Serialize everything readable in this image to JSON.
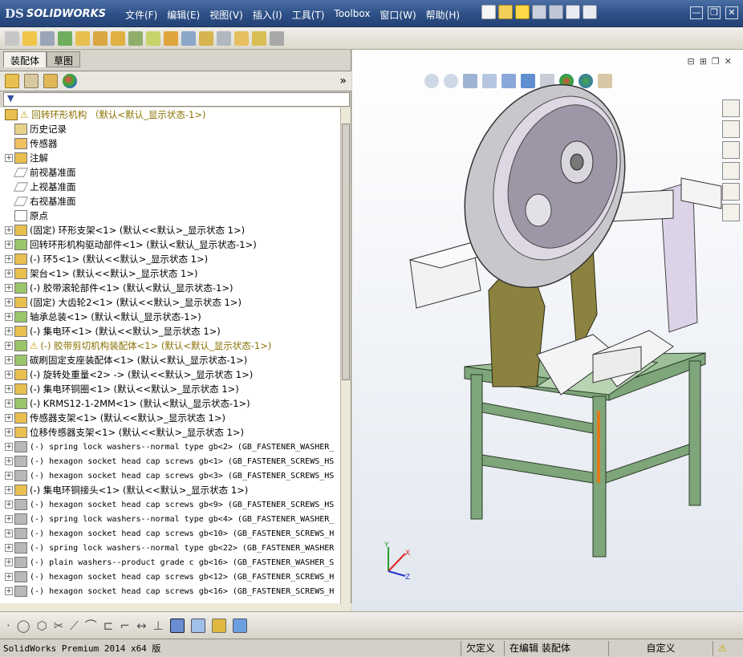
{
  "app": {
    "brand": "SOLIDWORKS",
    "brand_prefix": "DS"
  },
  "menu": [
    "文件(F)",
    "编辑(E)",
    "视图(V)",
    "插入(I)",
    "工具(T)",
    "Toolbox",
    "窗口(W)",
    "帮助(H)"
  ],
  "window_controls": {
    "minimize": "—",
    "restore": "❐",
    "close": "✕"
  },
  "tabs": [
    {
      "label": "装配体",
      "active": true
    },
    {
      "label": "草图",
      "active": false
    }
  ],
  "fm_expand": "»",
  "tree": {
    "root": "回转环形机构  （默认<默认_显示状态-1>)",
    "items": [
      {
        "label": "历史记录",
        "icon": "history-icon",
        "exp": false,
        "mono": false
      },
      {
        "label": "传感器",
        "icon": "sensor-icon",
        "exp": false,
        "mono": false
      },
      {
        "label": "注解",
        "icon": "annotation-icon",
        "exp": true,
        "mono": false
      },
      {
        "label": "前视基准面",
        "icon": "plane-icon",
        "exp": false,
        "mono": false
      },
      {
        "label": "上视基准面",
        "icon": "plane-icon",
        "exp": false,
        "mono": false
      },
      {
        "label": "右视基准面",
        "icon": "plane-icon",
        "exp": false,
        "mono": false
      },
      {
        "label": "原点",
        "icon": "origin-icon",
        "exp": false,
        "mono": false
      },
      {
        "label": "(固定) 环形支架<1> (默认<<默认>_显示状态 1>)",
        "icon": "part-icon",
        "exp": true,
        "mono": false
      },
      {
        "label": "回转环形机构驱动部件<1> (默认<默认_显示状态-1>)",
        "icon": "assembly-icon",
        "exp": true,
        "mono": false
      },
      {
        "label": "(-) 环5<1> (默认<<默认>_显示状态 1>)",
        "icon": "part-icon",
        "exp": true,
        "mono": false
      },
      {
        "label": "架台<1> (默认<<默认>_显示状态 1>)",
        "icon": "part-icon",
        "exp": true,
        "mono": false
      },
      {
        "label": "(-) 胶带滚轮部件<1> (默认<默认_显示状态-1>)",
        "icon": "assembly-icon",
        "exp": true,
        "mono": false
      },
      {
        "label": "(固定) 大齿轮2<1> (默认<<默认>_显示状态 1>)",
        "icon": "part-icon",
        "exp": true,
        "mono": false
      },
      {
        "label": "轴承总装<1> (默认<默认_显示状态-1>)",
        "icon": "assembly-icon",
        "exp": true,
        "mono": false
      },
      {
        "label": "(-) 集电环<1> (默认<<默认>_显示状态 1>)",
        "icon": "part-icon",
        "exp": true,
        "mono": false
      },
      {
        "label": "(-) 胶带剪切机构装配体<1> (默认<默认_显示状态-1>)",
        "icon": "assembly-warning-icon",
        "exp": true,
        "mono": false,
        "warn": true
      },
      {
        "label": "碳刷固定支座装配体<1> (默认<默认_显示状态-1>)",
        "icon": "assembly-icon",
        "exp": true,
        "mono": false
      },
      {
        "label": "(-) 旋转处重量<2> -> (默认<<默认>_显示状态 1>)",
        "icon": "part-icon",
        "exp": true,
        "mono": false
      },
      {
        "label": "(-) 集电环铜圈<1> (默认<<默认>_显示状态 1>)",
        "icon": "part-icon",
        "exp": true,
        "mono": false
      },
      {
        "label": "(-) KRMS12-1-2MM<1> (默认<默认_显示状态-1>)",
        "icon": "assembly-icon",
        "exp": true,
        "mono": false
      },
      {
        "label": "传感器支架<1> (默认<<默认>_显示状态 1>)",
        "icon": "part-icon",
        "exp": true,
        "mono": false
      },
      {
        "label": "位移传感器支架<1> (默认<<默认>_显示状态 1>)",
        "icon": "part-icon",
        "exp": true,
        "mono": false
      },
      {
        "label": "(-) spring lock washers--normal type gb<2> (GB_FASTENER_WASHER_",
        "icon": "toolbox-part-icon",
        "exp": true,
        "mono": true
      },
      {
        "label": "(-) hexagon socket head cap screws gb<1> (GB_FASTENER_SCREWS_HS",
        "icon": "toolbox-part-icon",
        "exp": true,
        "mono": true
      },
      {
        "label": "(-) hexagon socket head cap screws gb<3> (GB_FASTENER_SCREWS_HS",
        "icon": "toolbox-part-icon",
        "exp": true,
        "mono": true
      },
      {
        "label": "(-) 集电环铜接头<1> (默认<<默认>_显示状态 1>)",
        "icon": "part-icon",
        "exp": true,
        "mono": false
      },
      {
        "label": "(-) hexagon socket head cap screws gb<9> (GB_FASTENER_SCREWS_HS",
        "icon": "toolbox-part-icon",
        "exp": true,
        "mono": true
      },
      {
        "label": "(-) spring lock washers--normal type gb<4> (GB_FASTENER_WASHER_",
        "icon": "toolbox-part-icon",
        "exp": true,
        "mono": true
      },
      {
        "label": "(-) hexagon socket head cap screws gb<10> (GB_FASTENER_SCREWS_H",
        "icon": "toolbox-part-icon",
        "exp": true,
        "mono": true
      },
      {
        "label": "(-) spring lock washers--normal type gb<22> (GB_FASTENER_WASHER",
        "icon": "toolbox-part-icon",
        "exp": true,
        "mono": true
      },
      {
        "label": "(-) plain washers--product grade c gb<16> (GB_FASTENER_WASHER_S",
        "icon": "toolbox-part-icon",
        "exp": true,
        "mono": true
      },
      {
        "label": "(-) hexagon socket head cap screws gb<12> (GB_FASTENER_SCREWS_H",
        "icon": "toolbox-part-icon",
        "exp": true,
        "mono": true
      },
      {
        "label": "(-) hexagon socket head cap screws gb<16> (GB_FASTENER_SCREWS_H",
        "icon": "toolbox-part-icon",
        "exp": true,
        "mono": true
      }
    ]
  },
  "triad": {
    "x": "X",
    "y": "Y",
    "z": "Z"
  },
  "status": {
    "product": "SolidWorks Premium 2014 x64 版",
    "constraint": "欠定义",
    "mode": "在编辑 装配体",
    "units": "自定义"
  },
  "colors": {
    "title_bar": "#2d4f86",
    "frame_green": "#7fa57a",
    "ring_gray": "#c8c8cc",
    "panel_lilac": "#ddd3e8",
    "warning": "#e5b800"
  }
}
